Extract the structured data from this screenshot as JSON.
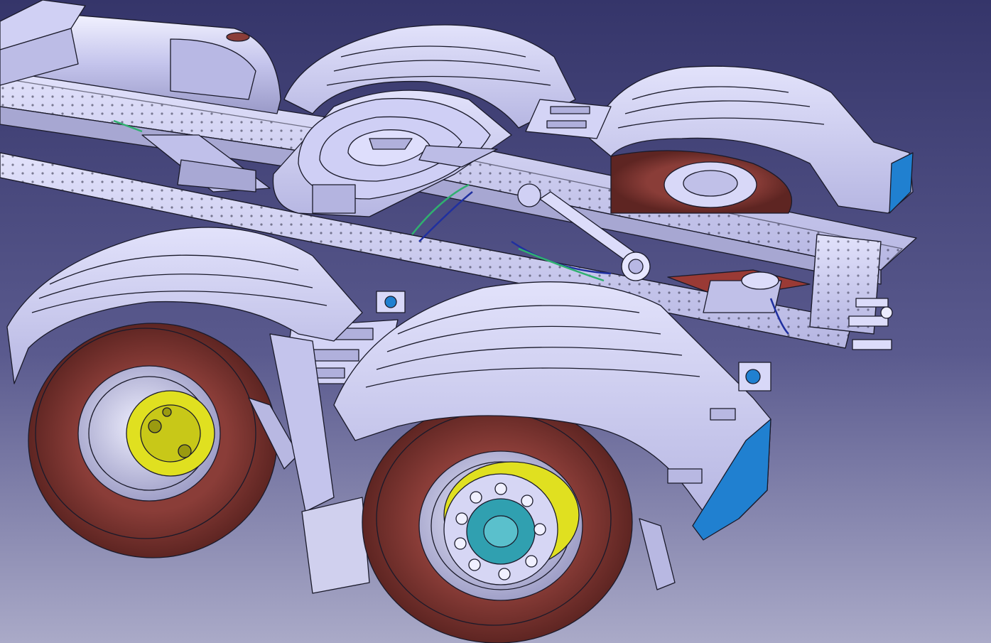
{
  "viewport": {
    "background_top": "#35356a",
    "background_bottom": "#aaaac8",
    "model_body": "#c8c8f0",
    "model_edge": "#1a1a2a",
    "tire": "#7a3530",
    "hub_yellow": "#e0e020",
    "hub_cyan": "#30a0b0",
    "accent_blue": "#2080d0",
    "wire_green": "#30b070",
    "wire_blue": "#2030a0"
  }
}
